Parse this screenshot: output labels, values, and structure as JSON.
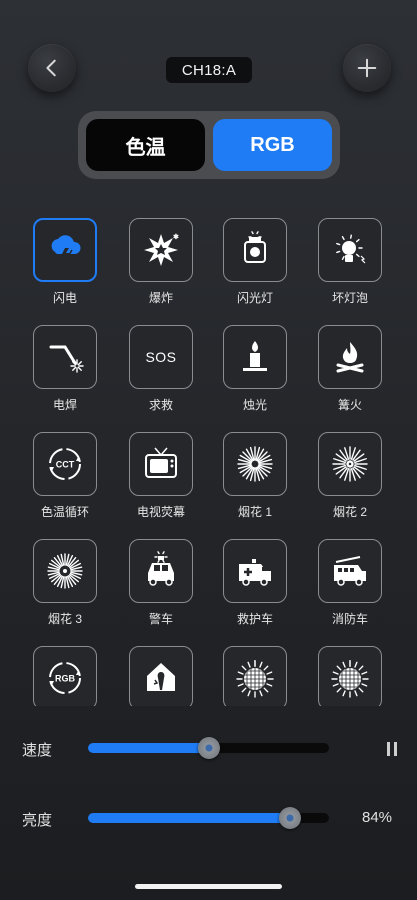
{
  "header": {
    "channel_label": "CH18:A",
    "back_icon": "chevron-left-icon",
    "add_icon": "plus-icon"
  },
  "mode_switch": {
    "cct_label": "色温",
    "rgb_label": "RGB",
    "selected": "RGB"
  },
  "effects": [
    {
      "label": "闪电",
      "icon": "lightning-icon",
      "active": true
    },
    {
      "label": "爆炸",
      "icon": "explosion-icon",
      "active": false
    },
    {
      "label": "闪光灯",
      "icon": "flash-lamp-icon",
      "active": false
    },
    {
      "label": "坏灯泡",
      "icon": "broken-bulb-icon",
      "active": false
    },
    {
      "label": "电焊",
      "icon": "welding-icon",
      "active": false
    },
    {
      "label": "求救",
      "icon": "sos-icon",
      "sos_text": "SOS",
      "active": false
    },
    {
      "label": "烛光",
      "icon": "candle-icon",
      "active": false
    },
    {
      "label": "篝火",
      "icon": "bonfire-icon",
      "active": false
    },
    {
      "label": "色温循环",
      "icon": "cct-cycle-icon",
      "cycle_text": "CCT",
      "active": false
    },
    {
      "label": "电视荧幕",
      "icon": "tv-icon",
      "active": false
    },
    {
      "label": "烟花 1",
      "icon": "fireworks-1-icon",
      "active": false
    },
    {
      "label": "烟花 2",
      "icon": "fireworks-2-icon",
      "active": false
    },
    {
      "label": "烟花 3",
      "icon": "fireworks-3-icon",
      "active": false
    },
    {
      "label": "警车",
      "icon": "police-car-icon",
      "active": false
    },
    {
      "label": "救护车",
      "icon": "ambulance-icon",
      "active": false
    },
    {
      "label": "消防车",
      "icon": "fire-truck-icon",
      "active": false
    },
    {
      "label": "",
      "icon": "rgb-cycle-icon",
      "cycle_text": "RGB",
      "active": false
    },
    {
      "label": "",
      "icon": "party-icon",
      "active": false
    },
    {
      "label": "",
      "icon": "disco-ball-icon",
      "active": false
    },
    {
      "label": "",
      "icon": "disco-ball-2-icon",
      "active": false
    }
  ],
  "sliders": {
    "speed": {
      "label": "速度",
      "fraction": 0.5,
      "control_icon": "pause-icon"
    },
    "brightness": {
      "label": "亮度",
      "fraction": 0.84,
      "value_text": "84%"
    }
  },
  "colors": {
    "accent": "#1f7cf5",
    "background": "#25272b",
    "tile_border": "#8a8c90"
  }
}
